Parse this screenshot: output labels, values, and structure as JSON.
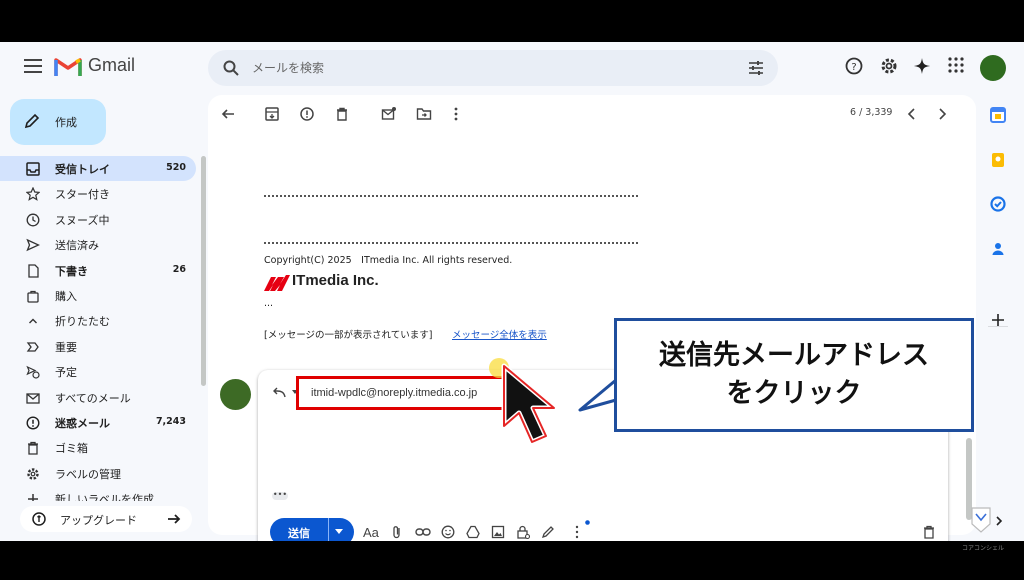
{
  "app": {
    "name": "Gmail",
    "colors": {
      "accent": "#0b57d0",
      "compose_bg": "#c2e7ff",
      "active_nav": "#d3e3fd",
      "highlight_red": "#e00000",
      "callout_border": "#1f4e9d"
    }
  },
  "search": {
    "placeholder": "メールを検索"
  },
  "compose": {
    "label": "作成"
  },
  "nav": {
    "items": [
      {
        "label": "受信トレイ",
        "count": "520",
        "icon": "inbox-icon",
        "active": true,
        "bold": true
      },
      {
        "label": "スター付き",
        "count": "",
        "icon": "star-icon"
      },
      {
        "label": "スヌーズ中",
        "count": "",
        "icon": "clock-icon"
      },
      {
        "label": "送信済み",
        "count": "",
        "icon": "send-icon"
      },
      {
        "label": "下書き",
        "count": "26",
        "icon": "draft-icon",
        "bold": true
      },
      {
        "label": "購入",
        "count": "",
        "icon": "bag-icon"
      },
      {
        "label": "折りたたむ",
        "count": "",
        "icon": "chevron-up-icon"
      },
      {
        "label": "重要",
        "count": "",
        "icon": "important-icon"
      },
      {
        "label": "予定",
        "count": "",
        "icon": "scheduled-icon"
      },
      {
        "label": "すべてのメール",
        "count": "",
        "icon": "all-mail-icon"
      },
      {
        "label": "迷惑メール",
        "count": "7,243",
        "icon": "spam-icon",
        "bold": true
      },
      {
        "label": "ゴミ箱",
        "count": "",
        "icon": "trash-icon"
      },
      {
        "label": "ラベルの管理",
        "count": "",
        "icon": "gear-icon"
      },
      {
        "label": "新しいラベルを作成",
        "count": "",
        "icon": "plus-icon"
      }
    ]
  },
  "upgrade": {
    "label": "アップグレード"
  },
  "toolbar": {
    "pager": "6 / 3,339"
  },
  "message": {
    "rule_text": "================================================================",
    "copyright": "Copyright(C) 2025　ITmedia Inc. All rights reserved.",
    "company_logo_text": "ITmedia Inc.",
    "ellipsis": "...",
    "clipped_note": "[メッセージの一部が表示されています]",
    "view_full_link": "メッセージ全体を表示"
  },
  "reply": {
    "recipient": "itmid-wpdlc@noreply.itmedia.co.jp",
    "send_label": "送信",
    "format_label": "Aa",
    "dots": "•••"
  },
  "callout": {
    "line1": "送信先メールアドレス",
    "line2": "をクリック"
  },
  "watermark": {
    "text": "コアコンシェル"
  }
}
